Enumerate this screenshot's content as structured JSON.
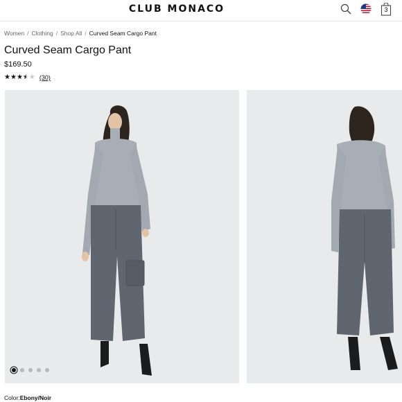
{
  "header": {
    "logo": "CLUB MONACO",
    "cart_count": "3"
  },
  "breadcrumb": [
    "Women",
    "Clothing",
    "Shop All",
    "Curved Seam Cargo Pant"
  ],
  "product": {
    "title": "Curved Seam Cargo Pant",
    "price": "$169.50",
    "rating": 3.5,
    "review_count": "(30)",
    "color_label": "Color:",
    "color_value": "Ebony/Noir"
  },
  "gallery": {
    "image_count": 5,
    "active_index": 0
  },
  "icons": [
    "search-icon",
    "us-flag-icon",
    "shopping-bag-icon",
    "star-icon"
  ],
  "colors": {
    "background": "#ffffff",
    "photo_bg": "#e9eaec",
    "text": "#111111",
    "muted": "#666666",
    "pants": "#5f6670",
    "top": "#a8aeb6"
  }
}
